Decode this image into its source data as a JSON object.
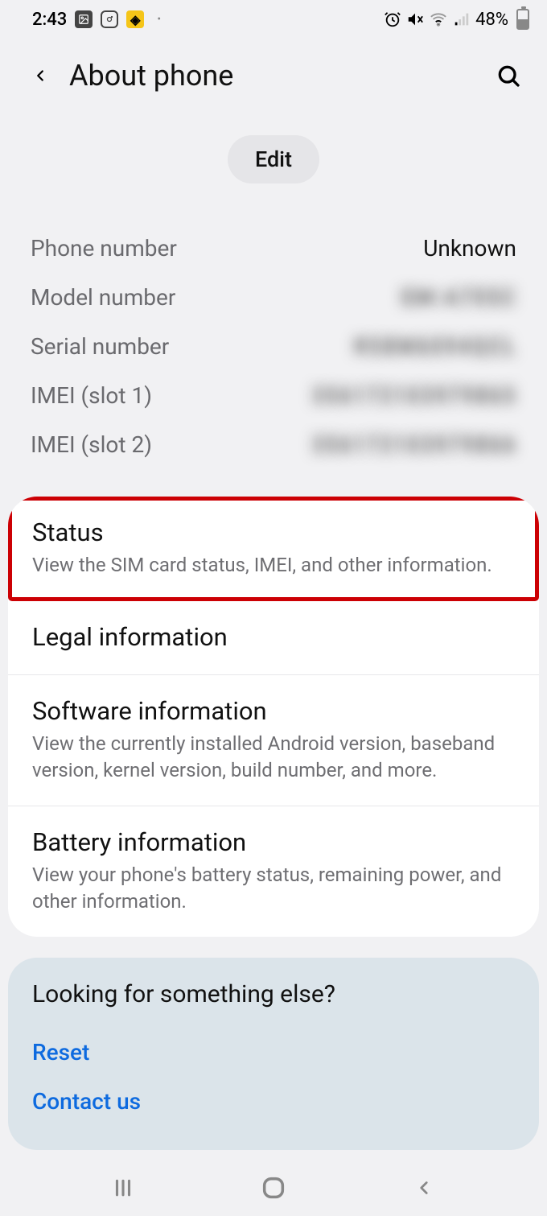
{
  "status_bar": {
    "time": "2:43",
    "battery_text": "48%"
  },
  "header": {
    "title": "About phone"
  },
  "edit_button": "Edit",
  "info": [
    {
      "label": "Phone number",
      "value": "Unknown",
      "blur": false
    },
    {
      "label": "Model number",
      "value": "SM-A705C",
      "blur": true
    },
    {
      "label": "Serial number",
      "value": "R58M6094QCL",
      "blur": true
    },
    {
      "label": "IMEI (slot 1)",
      "value": "356172103979865",
      "blur": true
    },
    {
      "label": "IMEI (slot 2)",
      "value": "356172103979866",
      "blur": true
    }
  ],
  "sections": [
    {
      "title": "Status",
      "subtitle": "View the SIM card status, IMEI, and other information.",
      "highlight": true
    },
    {
      "title": "Legal information",
      "subtitle": "",
      "highlight": false
    },
    {
      "title": "Software information",
      "subtitle": "View the currently installed Android version, baseband version, kernel version, build number, and more.",
      "highlight": false
    },
    {
      "title": "Battery information",
      "subtitle": "View your phone's battery status, remaining power, and other information.",
      "highlight": false
    }
  ],
  "secondary": {
    "title": "Looking for something else?",
    "links": [
      "Reset",
      "Contact us"
    ]
  }
}
